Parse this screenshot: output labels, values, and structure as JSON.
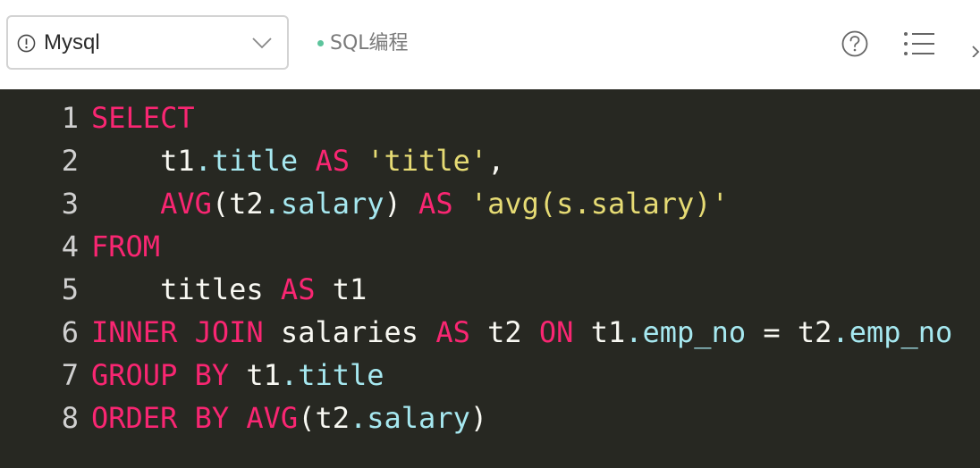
{
  "toolbar": {
    "language": "Mysql",
    "mode_label": "SQL编程",
    "icons": [
      "info-icon",
      "chevron-down-icon",
      "help-icon",
      "list-icon",
      "chevron-right-icon"
    ]
  },
  "colors": {
    "editor_bg": "#272822",
    "keyword": "#f92672",
    "property": "#a6e8f0",
    "string": "#e6db74",
    "plain": "#f8f8f2",
    "status_dot": "#5cc49c"
  },
  "code": {
    "lines": [
      {
        "num": "1",
        "tokens": [
          {
            "t": "SELECT",
            "c": "kw"
          }
        ]
      },
      {
        "num": "2",
        "tokens": [
          {
            "t": "    t1",
            "c": "plain"
          },
          {
            "t": ".title",
            "c": "prop"
          },
          {
            "t": " ",
            "c": "plain"
          },
          {
            "t": "AS",
            "c": "kw"
          },
          {
            "t": " ",
            "c": "plain"
          },
          {
            "t": "'title'",
            "c": "str"
          },
          {
            "t": ",",
            "c": "plain"
          }
        ]
      },
      {
        "num": "3",
        "tokens": [
          {
            "t": "    ",
            "c": "plain"
          },
          {
            "t": "AVG",
            "c": "kw"
          },
          {
            "t": "(t2",
            "c": "plain"
          },
          {
            "t": ".salary",
            "c": "prop"
          },
          {
            "t": ") ",
            "c": "plain"
          },
          {
            "t": "AS",
            "c": "kw"
          },
          {
            "t": " ",
            "c": "plain"
          },
          {
            "t": "'avg(s.salary)'",
            "c": "str"
          }
        ]
      },
      {
        "num": "4",
        "tokens": [
          {
            "t": "FROM",
            "c": "kw"
          }
        ]
      },
      {
        "num": "5",
        "tokens": [
          {
            "t": "    titles ",
            "c": "plain"
          },
          {
            "t": "AS",
            "c": "kw"
          },
          {
            "t": " t1",
            "c": "plain"
          }
        ]
      },
      {
        "num": "6",
        "tokens": [
          {
            "t": "INNER",
            "c": "kw"
          },
          {
            "t": " ",
            "c": "plain"
          },
          {
            "t": "JOIN",
            "c": "kw"
          },
          {
            "t": " salaries ",
            "c": "plain"
          },
          {
            "t": "AS",
            "c": "kw"
          },
          {
            "t": " t2 ",
            "c": "plain"
          },
          {
            "t": "ON",
            "c": "kw"
          },
          {
            "t": " t1",
            "c": "plain"
          },
          {
            "t": ".emp_no",
            "c": "prop"
          },
          {
            "t": " = t2",
            "c": "plain"
          },
          {
            "t": ".emp_no",
            "c": "prop"
          }
        ]
      },
      {
        "num": "7",
        "tokens": [
          {
            "t": "GROUP",
            "c": "kw"
          },
          {
            "t": " ",
            "c": "plain"
          },
          {
            "t": "BY",
            "c": "kw"
          },
          {
            "t": " t1",
            "c": "plain"
          },
          {
            "t": ".title",
            "c": "prop"
          }
        ]
      },
      {
        "num": "8",
        "tokens": [
          {
            "t": "ORDER",
            "c": "kw"
          },
          {
            "t": " ",
            "c": "plain"
          },
          {
            "t": "BY",
            "c": "kw"
          },
          {
            "t": " ",
            "c": "plain"
          },
          {
            "t": "AVG",
            "c": "kw"
          },
          {
            "t": "(t2",
            "c": "plain"
          },
          {
            "t": ".salary",
            "c": "prop"
          },
          {
            "t": ")",
            "c": "plain"
          }
        ]
      }
    ]
  }
}
